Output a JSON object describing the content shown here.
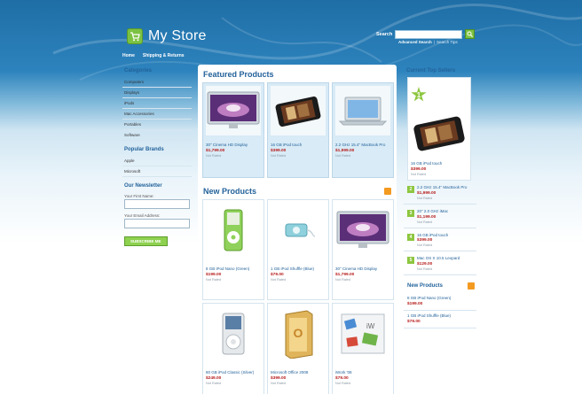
{
  "store": {
    "name": "My Store"
  },
  "nav": [
    "Home",
    "Shipping & Returns"
  ],
  "search": {
    "label": "Search",
    "advanced": "Advanced Search",
    "separator": "|",
    "tips": "Search Tips"
  },
  "sidebar": {
    "categories_title": "Categories",
    "categories": [
      "Computers",
      "Displays",
      "iPods",
      "Mac Accessories",
      "Portables",
      "Software"
    ],
    "brands_title": "Popular Brands",
    "brands": [
      "Apple",
      "Microsoft"
    ],
    "newsletter_title": "Our Newsletter",
    "first_name_label": "Your First Name:",
    "email_label": "Your Email Address:",
    "subscribe_label": "SUBSCRIBE ME"
  },
  "featured": {
    "title": "Featured Products",
    "items": [
      {
        "name": "30\" Cinema HD Display",
        "price": "$1,799.00",
        "stock": "Not Rated",
        "icon": "monitor"
      },
      {
        "name": "16 GB iPod touch",
        "price": "$399.00",
        "stock": "Not Rated",
        "icon": "ipod-touch"
      },
      {
        "name": "2.2 GHz 15.4\" MacBook Pro",
        "price": "$1,999.00",
        "stock": "Not Rated",
        "icon": "laptop"
      }
    ]
  },
  "new_products": {
    "title": "New Products",
    "items": [
      {
        "name": "8 GB iPod Nano (Green)",
        "price": "$199.00",
        "stock": "Not Rated",
        "icon": "ipod-nano"
      },
      {
        "name": "1 GB iPod Shuffle (Blue)",
        "price": "$79.00",
        "stock": "Not Rated",
        "icon": "ipod-shuffle"
      },
      {
        "name": "30\" Cinema HD Display",
        "price": "$1,799.00",
        "stock": "Not Rated",
        "icon": "monitor"
      },
      {
        "name": "80 GB iPod Classic (Silver)",
        "price": "$249.00",
        "stock": "Not Rated",
        "icon": "ipod-classic"
      },
      {
        "name": "Microsoft Office 2008",
        "price": "$399.00",
        "stock": "Not Rated",
        "icon": "office-box"
      },
      {
        "name": "iWork '08",
        "price": "$79.00",
        "stock": "Not Rated",
        "icon": "iwork-box"
      }
    ]
  },
  "top_sellers": {
    "title": "Current Top Sellers",
    "first": {
      "rank": "1",
      "name": "16 GB iPod touch",
      "price": "$399.00",
      "stock": "Not Rated"
    },
    "others": [
      {
        "rank": "2",
        "name": "2.2 GHz 15.4\" MacBook Pro",
        "price": "$1,999.00",
        "stock": "Not Rated"
      },
      {
        "rank": "3",
        "name": "20\" 2.0 GHz iMac",
        "price": "$1,199.00",
        "stock": "Not Rated"
      },
      {
        "rank": "4",
        "name": "16 GB iPod touch",
        "price": "$399.00",
        "stock": "Not Rated"
      },
      {
        "rank": "5",
        "name": "Mac OS X 10.5 Leopard",
        "price": "$129.00",
        "stock": "Not Rated"
      }
    ]
  },
  "right_new": {
    "title": "New Products",
    "items": [
      {
        "name": "8 GB iPod Nano (Green)",
        "price": "$199.00"
      },
      {
        "name": "1 GB iPod Shuffle (Blue)",
        "price": "$79.00"
      }
    ]
  },
  "colors": {
    "link": "#23629a",
    "price": "#b71c1c",
    "accent": "#8dc63f",
    "rss": "#f39a21"
  }
}
